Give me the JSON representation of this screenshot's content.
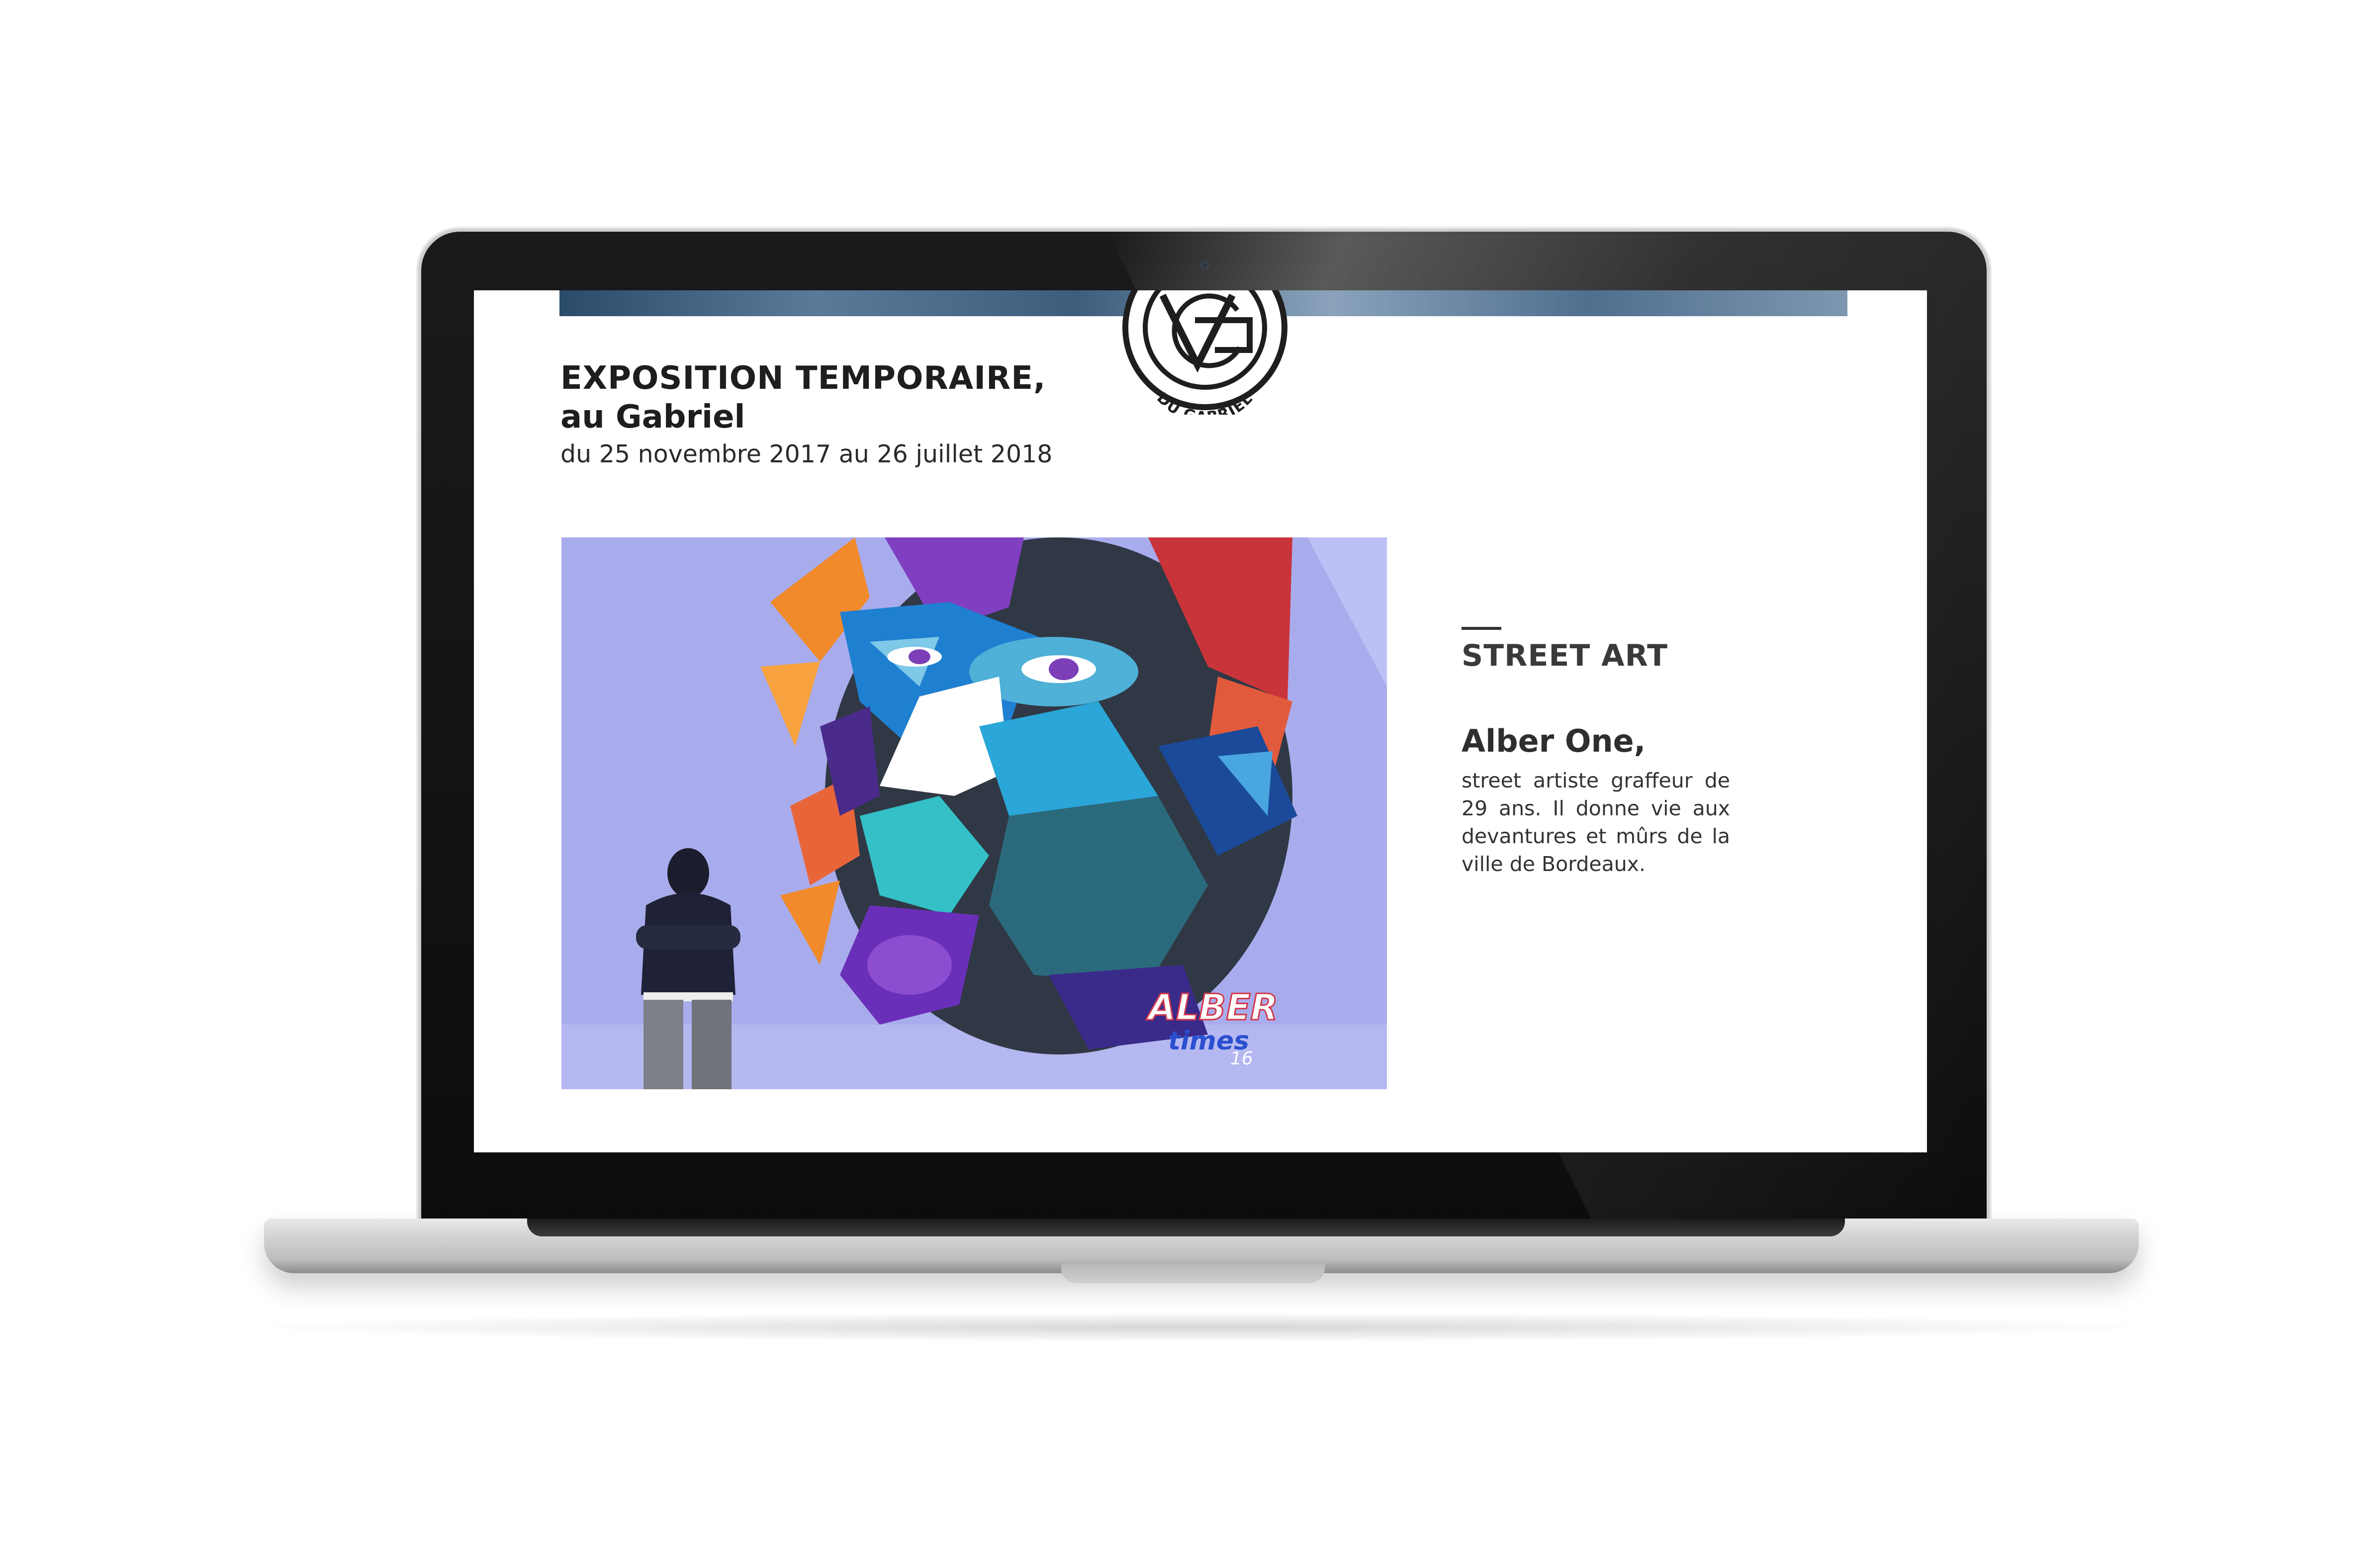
{
  "exhibition": {
    "title": "EXPOSITION TEMPORAIRE,",
    "subtitle": "au Gabriel",
    "dates": "du 25 novembre 2017 au 26 juillet 2018"
  },
  "logo": {
    "text": "DU GABRIEL"
  },
  "feature": {
    "section_label": "STREET ART",
    "artist_name": "Alber One,",
    "bio": "street artiste graffeur de 29 ans. Il donne vie aux devantures et mûrs de la ville de Bordeaux."
  },
  "mural": {
    "signature": "ALBER",
    "signature_sub": "times",
    "signature_year": "16"
  },
  "colors": {
    "screen_background": "#ffffff",
    "text_dark": "#1e1e1e",
    "wall": "#a9acec",
    "banner": "#3d5d7d"
  }
}
